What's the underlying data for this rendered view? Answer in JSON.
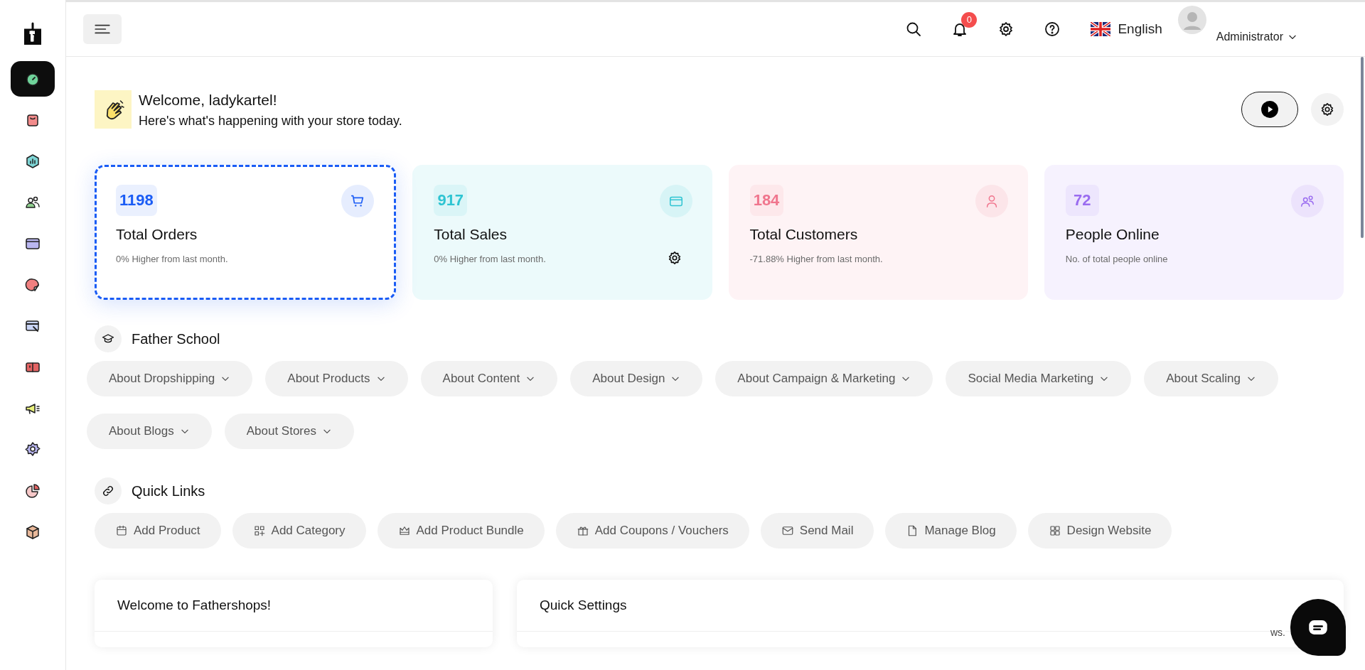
{
  "sidebar": {
    "items": [
      {
        "selected": true
      },
      {
        "selected": false
      },
      {
        "selected": false
      },
      {
        "selected": false
      },
      {
        "selected": false
      },
      {
        "selected": false
      },
      {
        "selected": false
      },
      {
        "selected": false
      },
      {
        "selected": false
      },
      {
        "selected": false
      },
      {
        "selected": false
      },
      {
        "selected": false
      }
    ]
  },
  "header": {
    "notifications": "0",
    "language": "English",
    "user": "Administrator"
  },
  "welcome": {
    "title": "Welcome, ladykartel!",
    "subtitle": "Here's what's happening with your store today."
  },
  "stats": [
    {
      "value": "1198",
      "label": "Total Orders",
      "note": "0% Higher from last month.",
      "color": "#1a5cf5",
      "focused": true,
      "settings": false
    },
    {
      "value": "917",
      "label": "Total Sales",
      "note": "0% Higher from last month.",
      "color": "#2ec4d2",
      "focused": false,
      "settings": true
    },
    {
      "value": "184",
      "label": "Total Customers",
      "note": "-71.88% Higher from last month.",
      "color": "#f0758d",
      "focused": false,
      "settings": false
    },
    {
      "value": "72",
      "label": "People Online",
      "note": "No. of total people online",
      "color": "#9a6cf0",
      "focused": false,
      "settings": false
    }
  ],
  "father_school": {
    "title": "Father School",
    "topics": [
      "About Dropshipping",
      "About Products",
      "About Content",
      "About Design",
      "About Campaign & Marketing",
      "Social Media Marketing",
      "About Scaling",
      "About Blogs",
      "About Stores"
    ]
  },
  "quick_links": {
    "title": "Quick Links",
    "links": [
      "Add Product",
      "Add Category",
      "Add Product Bundle",
      "Add Coupons / Vouchers",
      "Send Mail",
      "Manage Blog",
      "Design Website"
    ]
  },
  "panels": [
    {
      "title": "Welcome to Fathershops!"
    },
    {
      "title": "Quick Settings"
    }
  ],
  "chat": {
    "hidden_text": "ws."
  }
}
